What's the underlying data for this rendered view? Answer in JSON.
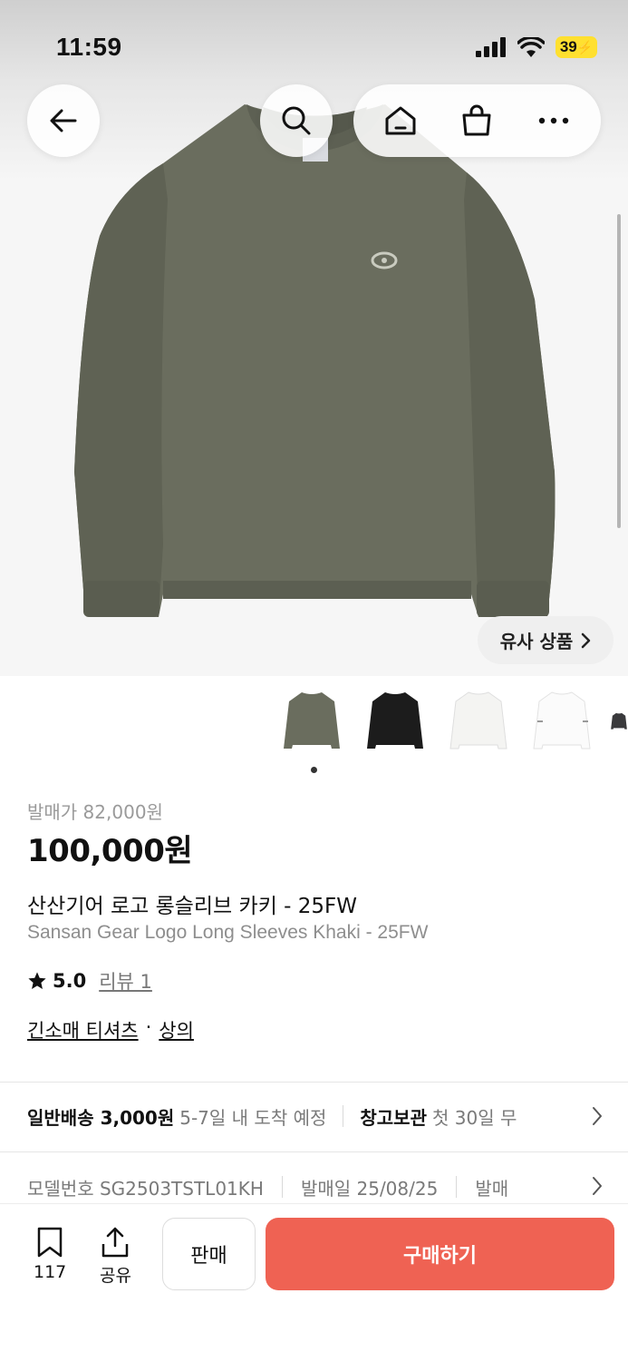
{
  "status_bar": {
    "time": "11:59",
    "battery": "39"
  },
  "nav": {
    "back_icon": "arrow-left-icon",
    "search_icon": "search-icon",
    "home_icon": "home-icon",
    "cart_icon": "shopping-bag-icon",
    "more_icon": "more-horizontal-icon"
  },
  "similar_products": {
    "label": "유사 상품"
  },
  "color_options": [
    "khaki",
    "black",
    "white",
    "white-stripe",
    "charcoal"
  ],
  "pricing": {
    "release_price": "발매가 82,000원",
    "price": "100,000원"
  },
  "product": {
    "name_ko": "산산기어 로고 롱슬리브 카키 - 25FW",
    "name_en": "Sansan Gear Logo Long Sleeves Khaki - 25FW",
    "rating": "5.0",
    "reviews": "리뷰 1",
    "category_1": "긴소매 티셔츠",
    "category_sep": "·",
    "category_2": "상의"
  },
  "shipping": {
    "label": "일반배송 3,000원",
    "eta": "5-7일 내 도착 예정",
    "storage_label": "창고보관",
    "storage_desc": "첫 30일 무"
  },
  "details": {
    "model": "모델번호 SG2503TSTL01KH",
    "release_date": "발매일 25/08/25",
    "extra": "발매"
  },
  "bottom_bar": {
    "wishlist_count": "117",
    "share_label": "공유",
    "sell_label": "판매",
    "buy_label": "구매하기"
  },
  "colors": {
    "buy": "#ef6253",
    "khaki": "#6b6e5f"
  }
}
